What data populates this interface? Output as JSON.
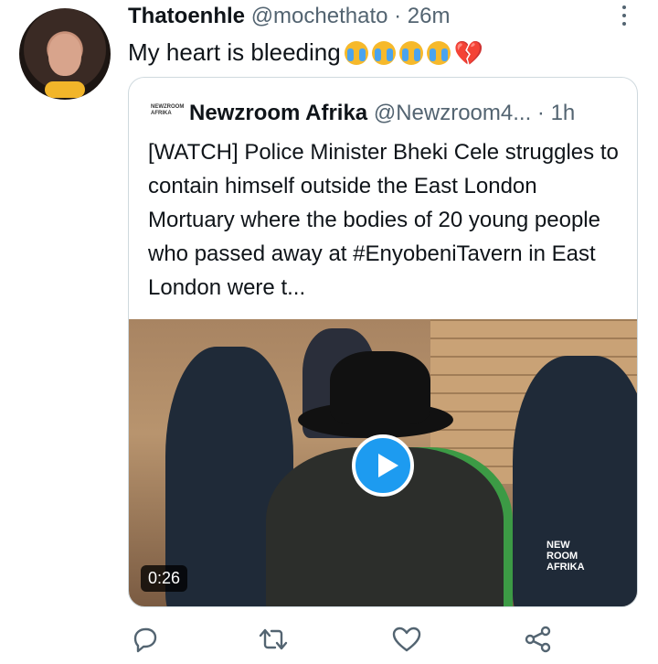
{
  "tweet": {
    "name": "Thatoenhle",
    "handle": "@mochethato",
    "time": "· 26m",
    "text": "My heart is bleeding"
  },
  "quoted": {
    "logo_text": "NEWZROOM AFRIKA",
    "name": "Newzroom Afrika",
    "handle": "@Newzroom4...",
    "time": "· 1h",
    "body": "[WATCH] Police Minister Bheki Cele struggles to contain himself outside the East London Mortuary where the bodies of 20 young people who passed away at #EnyobeniTavern in East London were t...",
    "video_duration": "0:26",
    "watermark": "NEW ROOM AFRIKA"
  },
  "icons": {
    "emoji": "crying-face-emoji",
    "broken_heart": "💔",
    "reply": "reply-icon",
    "retweet": "retweet-icon",
    "like": "like-icon",
    "share": "share-icon"
  },
  "colors": {
    "accent": "#1d9bf0",
    "secondary_text": "#536471",
    "border": "#cfd9de"
  }
}
